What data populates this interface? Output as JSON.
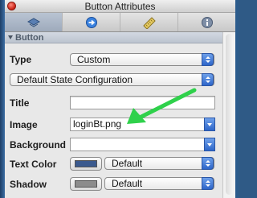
{
  "window": {
    "title": "Button Attributes"
  },
  "toolbar": {
    "tabs": [
      "attributes-icon",
      "connections-icon",
      "size-icon",
      "info-icon"
    ],
    "selected": 0
  },
  "section": {
    "title": "Button"
  },
  "type": {
    "label": "Type",
    "value": "Custom"
  },
  "state_config": {
    "value": "Default State Configuration"
  },
  "title_field": {
    "label": "Title",
    "value": ""
  },
  "image": {
    "label": "Image",
    "value": "loginBt.png"
  },
  "background": {
    "label": "Background",
    "value": ""
  },
  "text_color": {
    "label": "Text Color",
    "value": "Default",
    "swatch": "#3b5a8e"
  },
  "shadow": {
    "label": "Shadow",
    "value": "Default",
    "swatch": "#8c8c8c"
  },
  "annotation": {
    "color": "#2fd14b"
  }
}
